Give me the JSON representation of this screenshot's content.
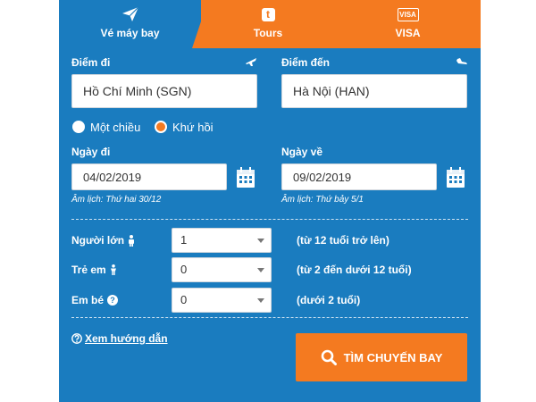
{
  "tabs": {
    "flight": {
      "label": "Vé máy bay",
      "icon": "paper-plane-icon"
    },
    "tours": {
      "label": "Tours",
      "icon": "tours-t-icon",
      "icon_text": "t"
    },
    "visa": {
      "label": "VISA",
      "icon": "visa-card-icon",
      "icon_text": "VISA"
    }
  },
  "route": {
    "from": {
      "label": "Điểm đi",
      "value": "Hồ Chí Minh (SGN)",
      "icon": "plane-departure-icon"
    },
    "to": {
      "label": "Điểm đến",
      "value": "Hà Nội (HAN)",
      "icon": "plane-arrival-icon"
    }
  },
  "trip_type": {
    "options": [
      {
        "label": "Một chiều",
        "checked": false
      },
      {
        "label": "Khứ hồi",
        "checked": true
      }
    ]
  },
  "dates": {
    "depart": {
      "label": "Ngày đi",
      "value": "04/02/2019",
      "lunar": "Âm lịch: Thứ hai 30/12",
      "icon": "calendar-icon"
    },
    "return": {
      "label": "Ngày về",
      "value": "09/02/2019",
      "lunar": "Âm lịch: Thứ bảy 5/1",
      "icon": "calendar-icon"
    }
  },
  "passengers": [
    {
      "label": "Người lớn",
      "icon": "adult-person-icon",
      "value": "1",
      "note": "(từ 12 tuổi trở lên)"
    },
    {
      "label": "Trẻ em",
      "icon": "child-person-icon",
      "value": "0",
      "note": "(từ 2 đến dưới 12 tuổi)"
    },
    {
      "label": "Em bé",
      "icon": "info-icon",
      "icon_text": "?",
      "value": "0",
      "note": "(dưới 2 tuổi)"
    }
  ],
  "guide": {
    "label": "Xem hướng dẫn",
    "icon": "help-circle-icon"
  },
  "search_button": {
    "label": "TÌM CHUYẾN BAY",
    "icon": "search-icon"
  },
  "colors": {
    "primary_blue": "#1a7cbf",
    "accent_orange": "#f47a20",
    "white": "#ffffff"
  }
}
